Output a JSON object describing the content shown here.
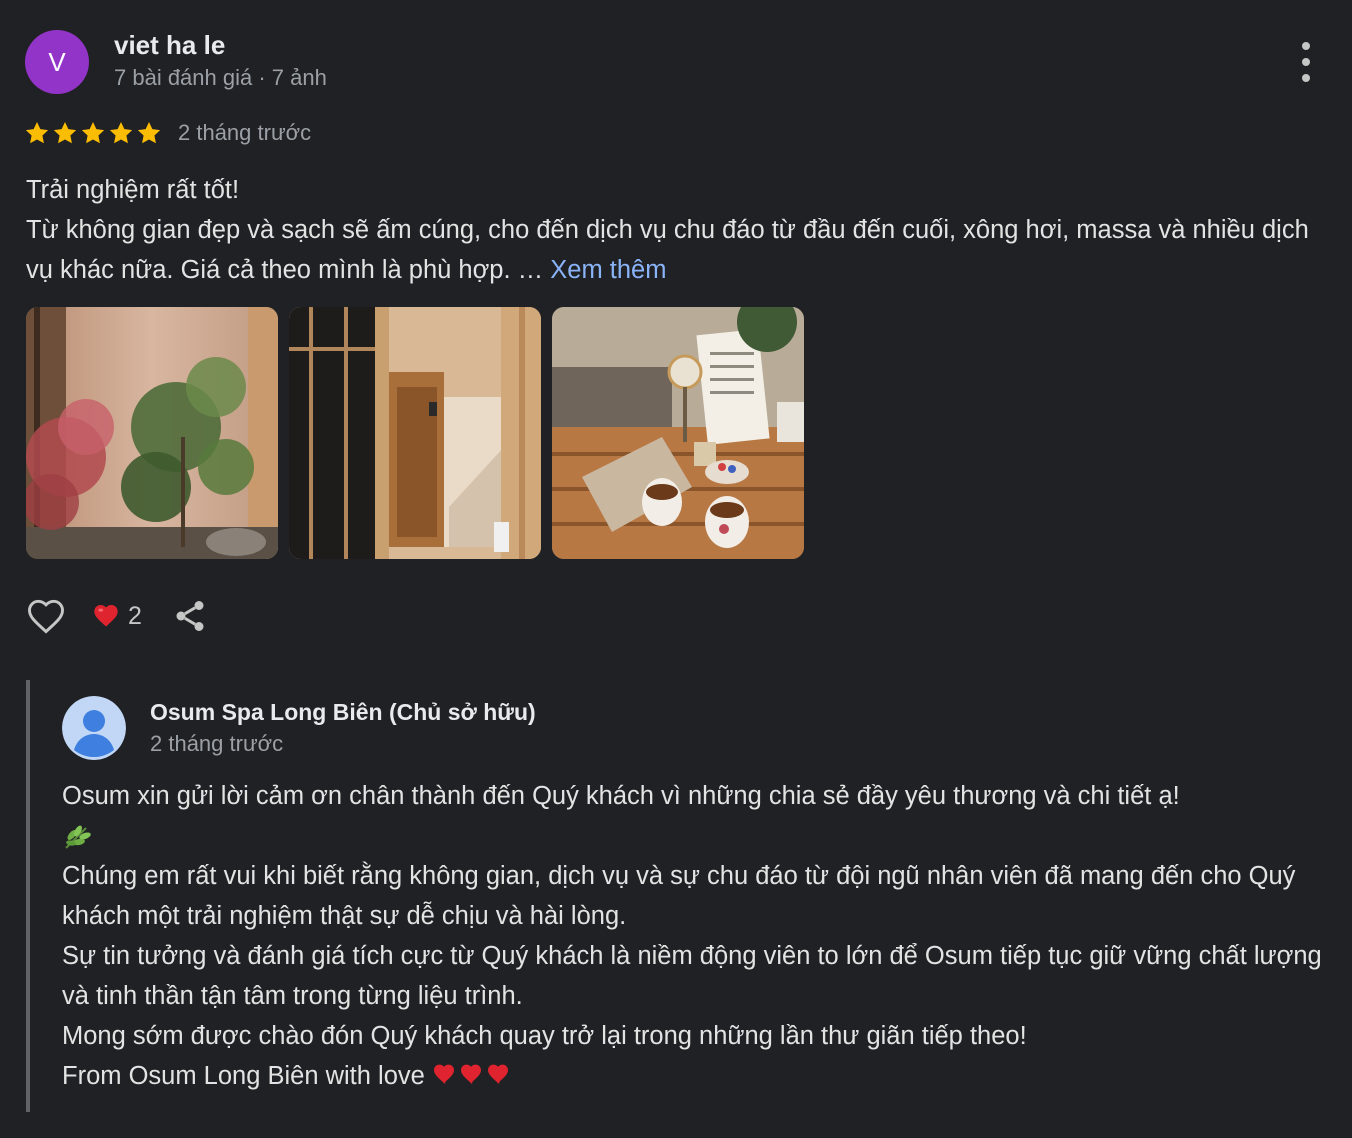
{
  "reviewer": {
    "initial": "V",
    "avatar_color": "#9334c9",
    "name": "viet ha le",
    "meta": "7 bài đánh giá · 7 ảnh"
  },
  "review": {
    "rating": 5,
    "time": "2 tháng trước",
    "lines": [
      "Trải nghiệm rất tốt!",
      "Từ không gian đẹp và sạch sẽ ấm cúng, cho đến dịch vụ chu đáo từ đầu đến cuối, xông hơi, massa và nhiều dịch vụ khác nữa. Giá cả theo mình là phù hợp. …"
    ],
    "see_more": "Xem thêm",
    "photos": [
      {
        "icon": "lobby-plants-photo"
      },
      {
        "icon": "stairway-doorway-photo"
      },
      {
        "icon": "tea-table-photo"
      }
    ]
  },
  "actions": {
    "like_icon": "heart-outline-icon",
    "reaction_icon": "red-heart-icon",
    "reaction_count": "2",
    "share_icon": "share-icon"
  },
  "owner_reply": {
    "name": "Osum Spa Long Biên (Chủ sở hữu)",
    "time": "2 tháng trước",
    "lines": [
      "Osum xin gửi lời cảm ơn chân thành đến Quý khách vì những chia sẻ đầy yêu thương và chi tiết ạ!",
      "Chúng em rất vui khi biết rằng không gian, dịch vụ và sự chu đáo từ đội ngũ nhân viên đã mang đến cho Quý khách một trải nghiệm thật sự dễ chịu và hài lòng.",
      "Sự tin tưởng và đánh giá tích cực từ Quý khách là niềm động viên to lớn để Osum tiếp tục giữ vững chất lượng và tinh thần tận tâm trong từng liệu trình.",
      "Mong sớm được chào đón Quý khách quay trở lại trong những lần thư giãn tiếp theo!",
      "From Osum Long Biên with love"
    ],
    "emoji_after_line1": "herb-leaf-icon",
    "emoji_after_last": "three-red-hearts-icon"
  },
  "colors": {
    "background": "#202124",
    "link": "#8ab4f8",
    "star": "#fbbc04",
    "secondary_text": "#9aa0a6"
  }
}
